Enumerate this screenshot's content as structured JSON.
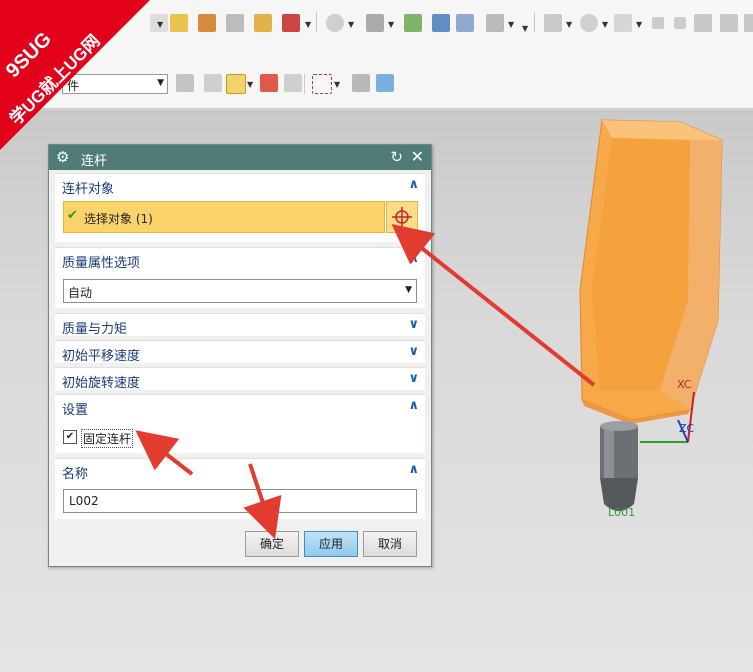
{
  "watermark": {
    "line1": "9SUG",
    "line2": "学UG就上UG网"
  },
  "toolbar": {
    "filter_value": "件",
    "icons": [
      "snap-icon",
      "sketch-icon",
      "tool-icon",
      "rotate-icon",
      "box-icon",
      "circle-icon",
      "arrow-icon",
      "clip-icon",
      "cube-icon",
      "layer-icon",
      "view-icon",
      "select-icon",
      "render-icon"
    ]
  },
  "dialog": {
    "title": "连杆",
    "sections": {
      "link_object": {
        "header": "连杆对象",
        "selected_label": "选择对象 (1)"
      },
      "mass_props": {
        "header": "质量属性选项",
        "value": "自动"
      },
      "mass_moment": {
        "header": "质量与力矩"
      },
      "init_translate": {
        "header": "初始平移速度"
      },
      "init_rotate": {
        "header": "初始旋转速度"
      },
      "settings": {
        "header": "设置",
        "fix_link_label": "固定连杆",
        "fix_link_checked": true
      },
      "name": {
        "header": "名称",
        "value": "L002"
      }
    },
    "buttons": {
      "ok": "确定",
      "apply": "应用",
      "cancel": "取消"
    }
  },
  "viewport": {
    "axis_x": "XC",
    "axis_z": "ZC",
    "part_label": "L001",
    "part_color": "#f7a849",
    "arrow_color": "#e23b2f"
  }
}
